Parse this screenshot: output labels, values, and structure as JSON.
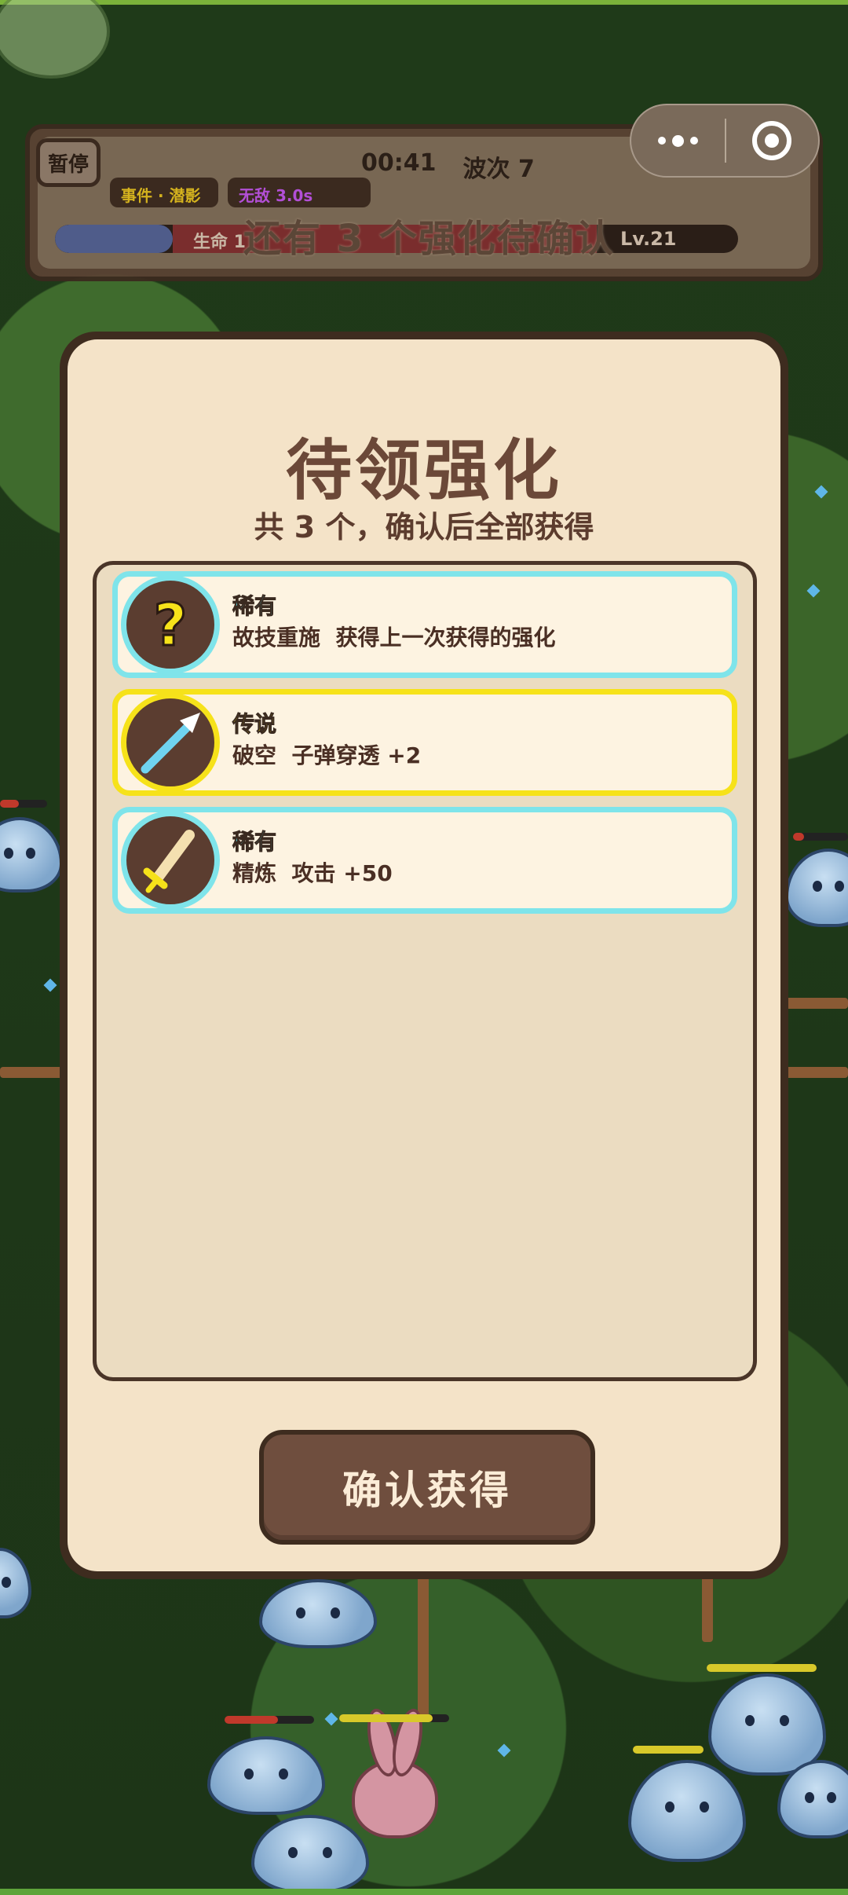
{
  "hud": {
    "pause_label": "暂停",
    "timer": "00:41",
    "wave": "波次 7",
    "event_chip": "事件 · 潜影",
    "invincible_chip": "无敌 3.0s",
    "life_label": "生命 1",
    "level": "Lv.21",
    "notice": "还有 3 个强化待确认"
  },
  "capsule": {
    "more_icon": "more-dots-icon",
    "close_icon": "target-close-icon"
  },
  "dialog": {
    "title": "待领强化",
    "subtitle": "共 3 个，确认后全部获得",
    "confirm_label": "确认获得"
  },
  "upgrades": [
    {
      "rarity": "稀有",
      "name": "故技重施",
      "effect": "获得上一次获得的强化",
      "icon": "question-mark-icon",
      "color": "#7fe4ea"
    },
    {
      "rarity": "传说",
      "name": "破空",
      "effect": "子弹穿透 +2",
      "icon": "arrow-icon",
      "color": "#f6e21a"
    },
    {
      "rarity": "稀有",
      "name": "精炼",
      "effect": "攻击 +50",
      "icon": "sword-icon",
      "color": "#7fe4ea"
    }
  ]
}
